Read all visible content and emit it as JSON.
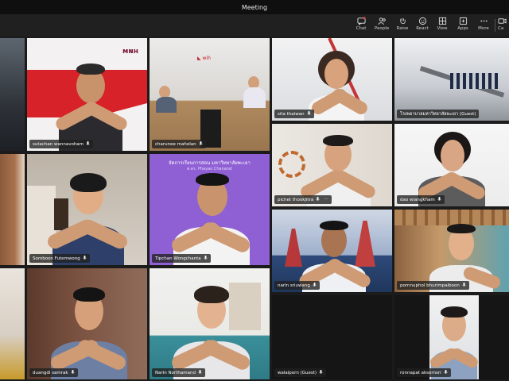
{
  "window": {
    "title": "Meeting"
  },
  "toolbar": {
    "items": [
      {
        "label": "Chat",
        "icon": "chat-icon"
      },
      {
        "label": "People",
        "icon": "people-icon"
      },
      {
        "label": "Raise",
        "icon": "raise-hand-icon"
      },
      {
        "label": "React",
        "icon": "react-icon"
      },
      {
        "label": "View",
        "icon": "view-icon"
      },
      {
        "label": "Apps",
        "icon": "apps-icon"
      },
      {
        "label": "More",
        "icon": "more-icon"
      },
      {
        "label": "Ca",
        "icon": "camera-icon"
      }
    ]
  },
  "participants": [
    {
      "name": "sutachan wannavoham"
    },
    {
      "name": "charunee maholan"
    },
    {
      "name": "sita thaiwan"
    },
    {
      "name": "โรงพยาบาลมหาวิทยาลัยพะเยา (Guest)"
    },
    {
      "name": "pichet thookjitra"
    },
    {
      "name": "dao wiangkham"
    },
    {
      "name": "Somboon Futemwong"
    },
    {
      "name": "Tipchan Wongchanta"
    },
    {
      "name": "narin sriuwang"
    },
    {
      "name": "pornnuphol bhurimpaiboon"
    },
    {
      "name": "duangdi samrak"
    },
    {
      "name": "Narin Northamand"
    },
    {
      "name": "walaiporn (Guest)"
    },
    {
      "name": "ronnapat aksornsri"
    }
  ],
  "banner": {
    "purple_text": "จัดการเรียนการสอน มหาวิทยาลัยพะเยา",
    "purple_sub": "ศ.ดร. Phayao Chanarat",
    "sign_text": "มหาวิทยาลัยพะเยา"
  },
  "colors": {
    "purple_bg": "#8f5fd4",
    "teams_bar": "#202020"
  }
}
